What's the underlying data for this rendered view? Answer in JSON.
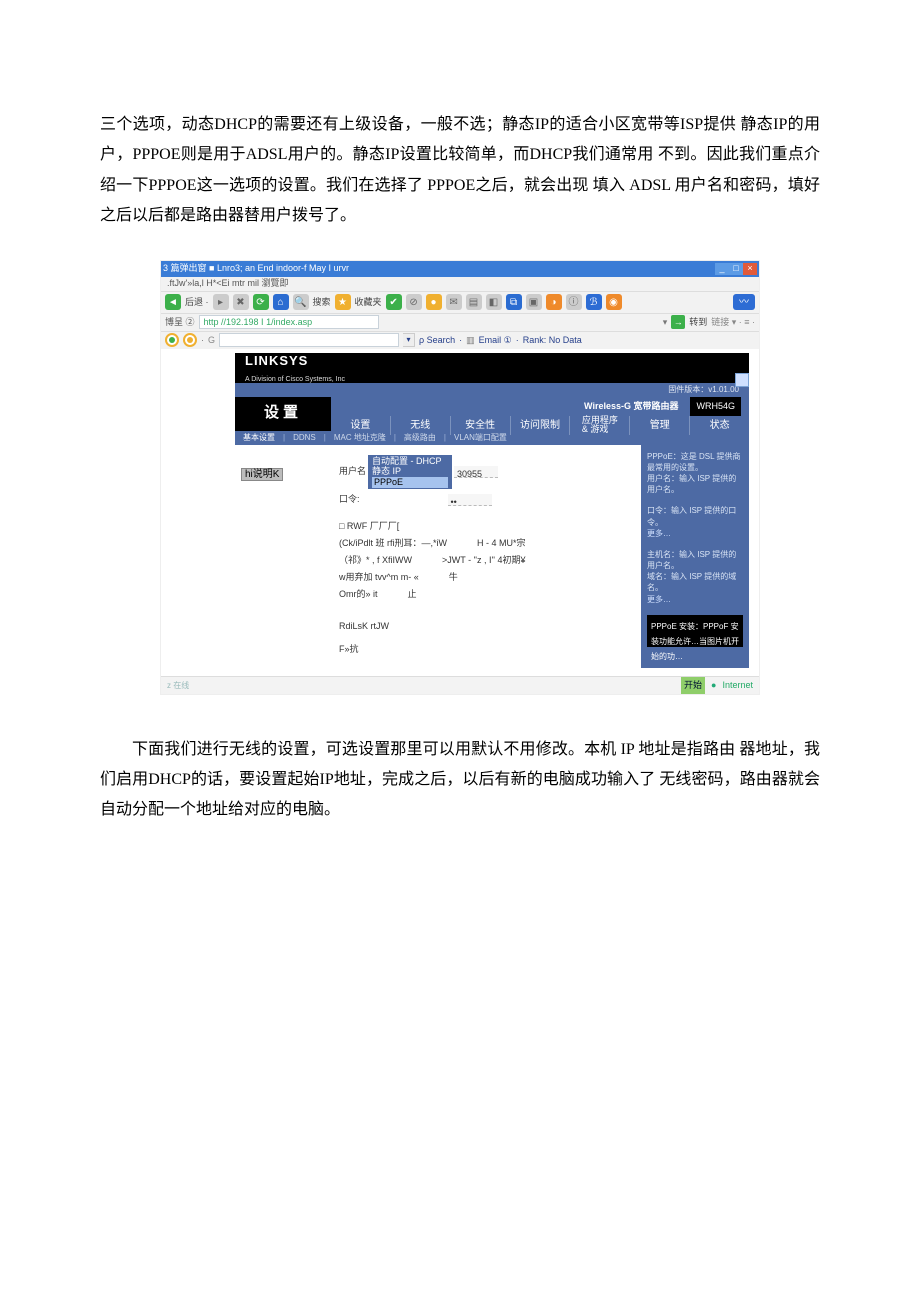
{
  "para1": "三个选项，动态DHCP的需要还有上级设备，一般不选；静态IP的适合小区宽带等ISP提供 静态IP的用户，PPPOE则是用于ADSL用户的。静态IP设置比较简单，而DHCP我们通常用 不到。因此我们重点介绍一下PPPOE这一选项的设置。我们在选择了 PPPOE之后，就会出现 填入 ADSL 用户名和密码，填好之后以后都是路由器替用户拨号了。",
  "para2": "下面我们进行无线的设置，可选设置那里可以用默认不用修改。本机 IP 地址是指路由 器地址，我们启用DHCP的话，要设置起始IP地址，完成之后，以后有新的电脑成功输入了 无线密码，路由器就会自动分配一个地址给对应的电脑。",
  "shot": {
    "title_prefix": "3 篇弹出窗",
    "title_rest": "■ Lnro3;  an End indoor-f May I urvr",
    "menubar": ".ftJw'»la,l H*<Ei mtr mil 瀏覽即",
    "addr_label": "博呈 ②",
    "addr_val": "http //192.198 I 1/index.asp",
    "go_label": "转到",
    "nav_back": "后退 ·",
    "toolbar_search": "搜索",
    "toolbar_fav": "收藏夹",
    "search_hint": "ρ Search",
    "search_email": "Email ①",
    "search_rank": "Rank: No Data",
    "logo": "LINKSYS",
    "logo_sub": "A Division of Cisco Systems, Inc",
    "fw": "固件版本：v1.01.00",
    "wireless_g": "Wireless-G 宽带路由器",
    "model": "WRH54G",
    "nav_left": "设置",
    "tabs": [
      "设置",
      "无线",
      "安全性",
      "访问限制",
      "应用程序\n& 游戏",
      "管理",
      "状态"
    ],
    "subnav": [
      "基本设置",
      "DDNS",
      "MAC 地址克隆",
      "高级路由",
      "VLAN端口配置"
    ],
    "section_label": "hi说明K",
    "fld_user_label": "用户名",
    "sel_opts": [
      "自动配置 - DHCP",
      "静态 IP",
      "PPPoE"
    ],
    "fld_user_val": "30955",
    "fld_pw_label": "口令:",
    "fld_pw_val": "••",
    "rows": [
      "□ RWF 厂厂厂[",
      "(Ck/iPdlt 班  rfi刑耳：—,*iW",
      "（祁》* , f XfiIWW",
      "w用弃加  tvv^m m- «",
      "Omr的» it"
    ],
    "row_right_1": "H - 4 MU*宗",
    "row_right_2": ">JWT - ''z , I'' 4初期¥",
    "row_right_3": "牛",
    "row_right_4": "止",
    "row_bottom_1": "RdiLsK rtJW",
    "row_bottom_2": "F»抗",
    "help": {
      "block1_1": "PPPoE：这是 DSL 提供商最常用的设置。",
      "block1_2": "用户名：输入 ISP 提供的用户名。",
      "block2_1": "口令：输入 ISP 提供的口令。",
      "more": "更多…",
      "block3_1": "主机名：输入 ISP 提供的用户名。",
      "block3_2": "域名：输入 ISP 提供的域名。",
      "foot1": "PPPoE 安装：PPPoF 安装功能允许…当图片机开始的功…",
      "foot2": ""
    },
    "status_done": "开始",
    "status_inet": "Internet",
    "status_logo": "z 在线"
  }
}
